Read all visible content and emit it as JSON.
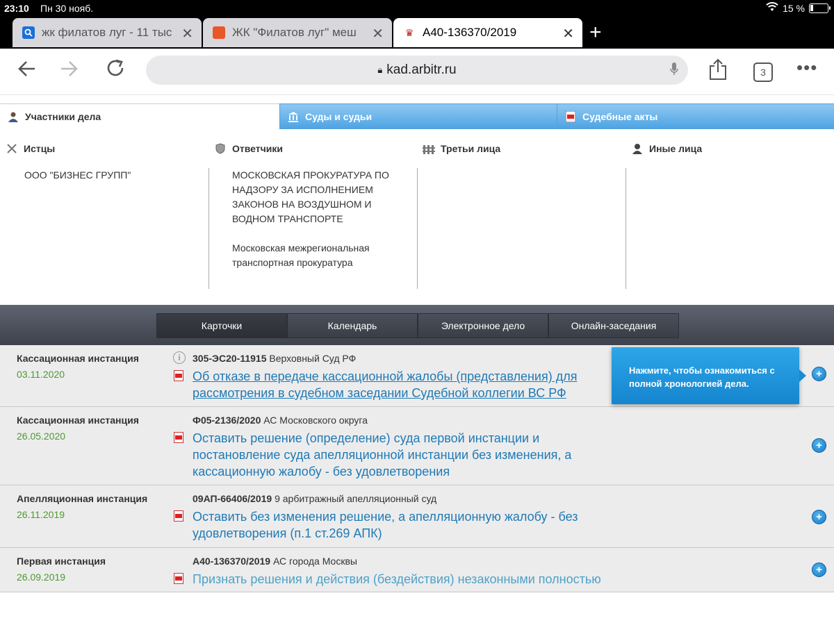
{
  "status": {
    "time": "23:10",
    "date": "Пн 30 нояб.",
    "battery": "15 %",
    "battery_level": 0.15
  },
  "tabs": [
    {
      "title": "жк филатов луг - 11 тыс",
      "active": false
    },
    {
      "title": "ЖК \"Филатов луг\" меш",
      "active": false
    },
    {
      "title": "А40-136370/2019",
      "active": true
    }
  ],
  "address": {
    "url": "kad.arbitr.ru",
    "tab_count": "3"
  },
  "site_tabs": {
    "participants": "Участники дела",
    "courts": "Суды и судьи",
    "acts": "Судебные акты"
  },
  "participants": {
    "plaintiffs": {
      "title": "Истцы",
      "items": [
        "ООО \"БИЗНЕС ГРУПП\""
      ]
    },
    "defendants": {
      "title": "Ответчики",
      "items": [
        "МОСКОВСКАЯ ПРОКУРАТУРА ПО НАДЗОРУ ЗА ИСПОЛНЕНИЕМ ЗАКОНОВ НА ВОЗДУШНОМ И ВОДНОМ ТРАНСПОРТЕ",
        "Московская межрегиональная транспортная прокуратура"
      ]
    },
    "third": {
      "title": "Третьи лица",
      "items": []
    },
    "other": {
      "title": "Иные лица",
      "items": []
    }
  },
  "view_nav": [
    "Карточки",
    "Календарь",
    "Электронное дело",
    "Онлайн-заседания"
  ],
  "cases": [
    {
      "instance": "Кассационная инстанция",
      "date": "03.11.2020",
      "number": "305-ЭС20-11915",
      "court": " Верховный Суд РФ",
      "document": "Об отказе в передаче кассационной жалобы (представления) для рассмотрения в судебном заседании Судебной коллегии ВС РФ"
    },
    {
      "instance": "Кассационная инстанция",
      "date": "26.05.2020",
      "number": "Ф05-2136/2020",
      "court": " АС Московского округа",
      "document": "Оставить решение (определение) суда первой инстанции и постановление суда апелляционной инстанции без изменения, а кассационную жалобу - без удовлетворения"
    },
    {
      "instance": "Апелляционная инстанция",
      "date": "26.11.2019",
      "number": "09АП-66406/2019",
      "court": " 9 арбитражный апелляционный суд",
      "document": "Оставить без изменения решение, а апелляционную жалобу - без удовлетворения (п.1 ст.269 АПК)"
    },
    {
      "instance": "Первая инстанция",
      "date": "26.09.2019",
      "number": "А40-136370/2019",
      "court": " АС города Москвы",
      "document": "Признать решения и действия (бездействия) незаконными полностью"
    }
  ],
  "tooltip": "Нажмите, чтобы ознакомиться с полной хронологией дела.",
  "colors": {
    "accent": "#1f7ab4",
    "date_green": "#4d9a2e",
    "tab_blue": "#4ea4e4"
  }
}
